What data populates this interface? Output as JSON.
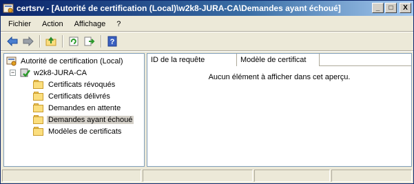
{
  "window": {
    "title": "certsrv - [Autorité de certification (Local)\\w2k8-JURA-CA\\Demandes ayant échoué]",
    "minimize_glyph": "_",
    "maximize_glyph": "□",
    "close_glyph": "X"
  },
  "menu": {
    "items": [
      "Fichier",
      "Action",
      "Affichage",
      "?"
    ]
  },
  "toolbar": {
    "buttons": [
      "back-arrow-icon",
      "forward-arrow-icon",
      "up-folder-icon",
      "refresh-icon",
      "export-list-icon",
      "help-icon"
    ]
  },
  "tree": {
    "root": "Autorité de certification (Local)",
    "ca": "w2k8-JURA-CA",
    "expander": "−",
    "folders": [
      "Certificats révoqués",
      "Certificats délivrés",
      "Demandes en attente",
      "Demandes ayant échoué",
      "Modèles de certificats"
    ],
    "selected": "Demandes ayant échoué"
  },
  "list": {
    "columns": [
      "ID de la requête",
      "Modèle de certificat"
    ],
    "empty_message": "Aucun élément à afficher dans cet aperçu."
  },
  "colors": {
    "title_gradient_start": "#0a246a",
    "title_gradient_end": "#a6caf0",
    "selection": "#d4d0c8",
    "pane_border": "#7f9db9"
  }
}
